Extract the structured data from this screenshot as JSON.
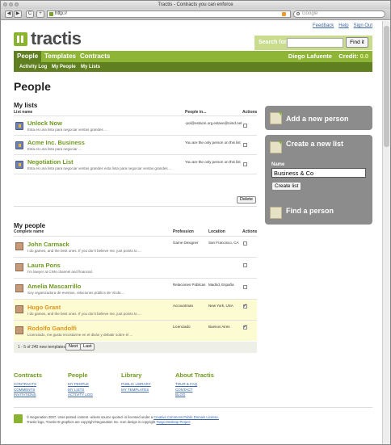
{
  "window": {
    "title": "Tractis - Contracts you can enforce"
  },
  "browser": {
    "url": "http://",
    "search_placeholder": "Google",
    "back": "◀",
    "forward": "▶",
    "reload": "C",
    "add": "+"
  },
  "toplinks": [
    "Feedback",
    "Help",
    "Sign Out"
  ],
  "logo": "tractis",
  "search": {
    "label": "Search for:",
    "button": "Find it"
  },
  "nav": {
    "tabs": [
      "People",
      "Templates",
      "Contracts"
    ],
    "user": "Diego Lafuente",
    "credit_label": "Credit:",
    "credit_value": "0.0"
  },
  "subnav": [
    "Activity Log",
    "My People",
    "My Lists"
  ],
  "page_title": "People",
  "my_lists": {
    "title": "My lists",
    "headers": [
      "List name",
      "People in...",
      "Actions"
    ],
    "rows": [
      {
        "name": "Unlock Now",
        "desc": "Esta es una lista para negociar ventas grandes ...",
        "people": "-pol@estacin.org.estave@nimd.net"
      },
      {
        "name": "Acme Inc. Business",
        "desc": "Esta es una lista para negociar ...",
        "people": "You are the only person on this list"
      },
      {
        "name": "Negotiation List",
        "desc": "Esta es una lista para negociar ventas grandes esta lista para negociar ventas grandes ...",
        "people": "You are the only person on this list"
      }
    ],
    "delete": "Delete"
  },
  "my_people": {
    "title": "My people",
    "headers": [
      "Complete name",
      "Profession",
      "Location",
      "Actions"
    ],
    "rows": [
      {
        "name": "John Carmack",
        "desc": "I do games, and the best ones. If you don't believe me, just points to ...",
        "profession": "Game Designer",
        "location": "San Francisco, CA",
        "checked": false,
        "highlight": false
      },
      {
        "name": "Laura Pons",
        "desc": "I'm lawyer at CNN channel and financial.",
        "profession": "",
        "location": "",
        "checked": false,
        "highlight": false
      },
      {
        "name": "Amelia Mascarrillo",
        "desc": "Soy organizadora de eventos, relaciones públics de Vicda ...",
        "profession": "Relaciones Públicas",
        "location": "Madrid, España",
        "checked": false,
        "highlight": false
      },
      {
        "name": "Hugo Grant",
        "desc": "I do games, and the best ones. If you don't believe me, just points to ...",
        "profession": "Accountman",
        "location": "New York, USA",
        "checked": true,
        "highlight": true
      },
      {
        "name": "Rodolfo Gandolfi",
        "desc": "Licenciado, me gusta recostarme en el diván y debatir sobre el ...",
        "profession": "Licenciado",
        "location": "Buenos Aires",
        "checked": true,
        "highlight": true
      }
    ],
    "pager": {
      "text": "1 - 5 of 240 new templates",
      "next": "Next",
      "last": "Last"
    }
  },
  "sidebar": {
    "add_person": "Add a new person",
    "create_list": "Create a new list",
    "name_label": "Name",
    "name_value": "Business & Co",
    "create_button": "Create list",
    "find_person": "Find a person"
  },
  "footer": {
    "columns": [
      {
        "title": "Contracts",
        "links": [
          "CONTRACTS",
          "COMMENTS",
          "INVITATIONS"
        ]
      },
      {
        "title": "People",
        "links": [
          "MY PEOPLE",
          "MY LISTS",
          "ACTIVITY LOG"
        ]
      },
      {
        "title": "Library",
        "links": [
          "PUBLIC LIBRARY",
          "MY TEMPLATES"
        ]
      },
      {
        "title": "About Tractis",
        "links": [
          "TOUR & FAQ",
          "CONTACT",
          "BLOG"
        ]
      }
    ],
    "legal_1a": "© Negonation 2007. User-posted content -unless source quoted- is licensed under a",
    "legal_1b": "Creative Commons Public Domain License.",
    "legal_2a": "Tractis logo, Tractis ID graphics are copyright Negonation Inc. Icon design is copyright",
    "legal_2b": "Tango Desktop Project"
  }
}
